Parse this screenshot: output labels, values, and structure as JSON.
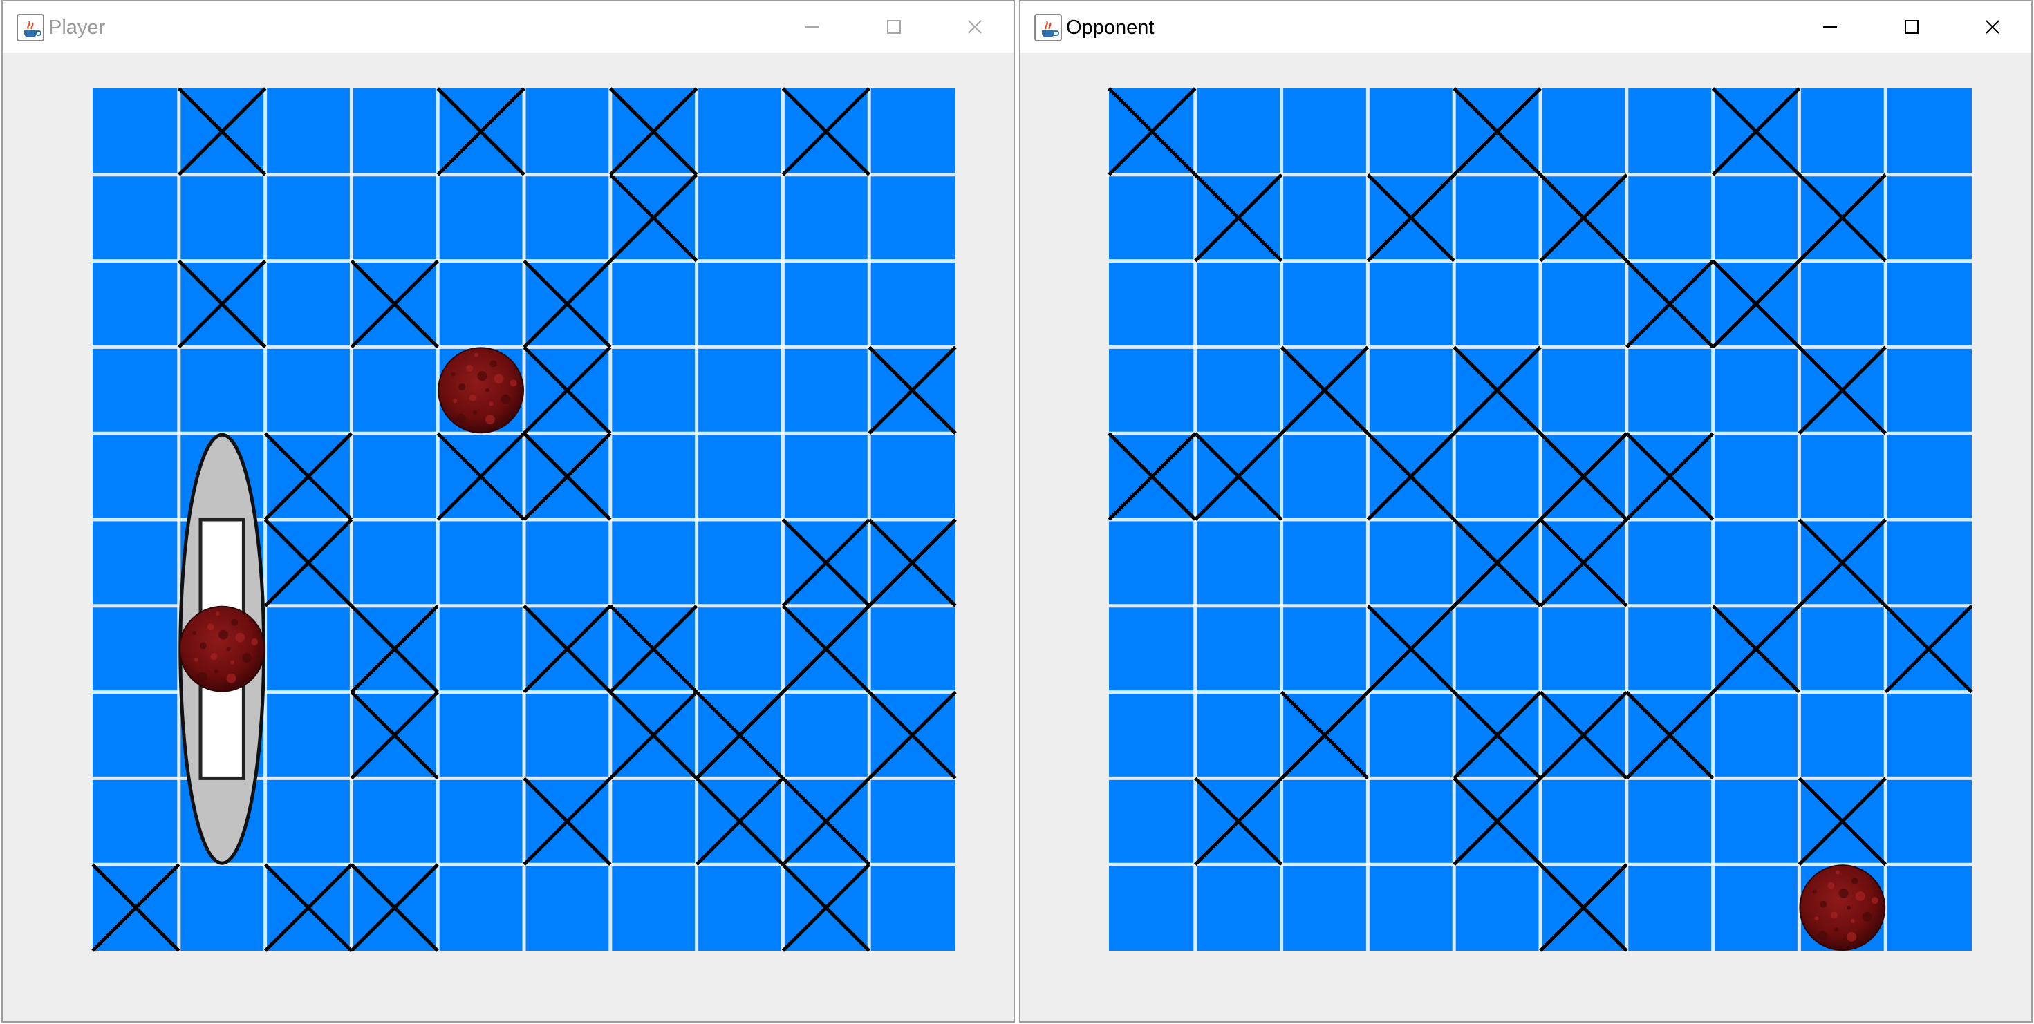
{
  "windows": {
    "player": {
      "title": "Player",
      "controls": {
        "minimize": "minimize-icon",
        "maximize": "maximize-icon",
        "close": "close-icon"
      }
    },
    "opponent": {
      "title": "Opponent",
      "controls": {
        "minimize": "minimize-icon",
        "maximize": "maximize-icon",
        "close": "close-icon"
      }
    }
  },
  "colors": {
    "water": "#0080ff",
    "grid_line": "#ffffff",
    "window_bg": "#eeeeee",
    "hit": "#6a0d0d",
    "ship": "#c2c2c2"
  },
  "boards": {
    "player": {
      "grid_size": 10,
      "misses": [
        [
          1,
          0
        ],
        [
          4,
          0
        ],
        [
          6,
          0
        ],
        [
          8,
          0
        ],
        [
          6,
          1
        ],
        [
          1,
          2
        ],
        [
          3,
          2
        ],
        [
          5,
          2
        ],
        [
          5,
          3
        ],
        [
          9,
          3
        ],
        [
          2,
          4
        ],
        [
          4,
          4
        ],
        [
          5,
          4
        ],
        [
          2,
          5
        ],
        [
          8,
          5
        ],
        [
          9,
          5
        ],
        [
          3,
          6
        ],
        [
          5,
          6
        ],
        [
          6,
          6
        ],
        [
          8,
          6
        ],
        [
          3,
          7
        ],
        [
          6,
          7
        ],
        [
          7,
          7
        ],
        [
          9,
          7
        ],
        [
          5,
          8
        ],
        [
          7,
          8
        ],
        [
          8,
          8
        ],
        [
          0,
          9
        ],
        [
          2,
          9
        ],
        [
          3,
          9
        ],
        [
          8,
          9
        ]
      ],
      "hits": [
        [
          4,
          3
        ],
        [
          1,
          6
        ]
      ],
      "ships": [
        {
          "name": "ship-vertical-5",
          "col": 1,
          "row": 4,
          "length": 5,
          "orientation": "vertical"
        }
      ]
    },
    "opponent": {
      "grid_size": 10,
      "misses": [
        [
          0,
          0
        ],
        [
          4,
          0
        ],
        [
          7,
          0
        ],
        [
          1,
          1
        ],
        [
          3,
          1
        ],
        [
          5,
          1
        ],
        [
          8,
          1
        ],
        [
          6,
          2
        ],
        [
          7,
          2
        ],
        [
          2,
          3
        ],
        [
          4,
          3
        ],
        [
          8,
          3
        ],
        [
          0,
          4
        ],
        [
          1,
          4
        ],
        [
          3,
          4
        ],
        [
          5,
          4
        ],
        [
          6,
          4
        ],
        [
          4,
          5
        ],
        [
          5,
          5
        ],
        [
          8,
          5
        ],
        [
          3,
          6
        ],
        [
          7,
          6
        ],
        [
          9,
          6
        ],
        [
          2,
          7
        ],
        [
          4,
          7
        ],
        [
          5,
          7
        ],
        [
          6,
          7
        ],
        [
          1,
          8
        ],
        [
          4,
          8
        ],
        [
          8,
          8
        ],
        [
          5,
          9
        ]
      ],
      "hits": [
        [
          8,
          9
        ]
      ],
      "ships": []
    }
  }
}
